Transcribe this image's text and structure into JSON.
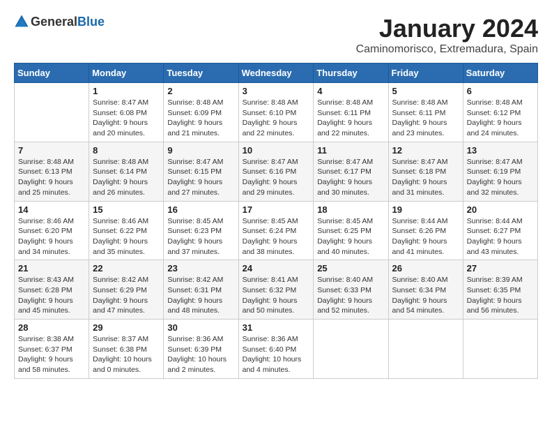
{
  "logo": {
    "text_general": "General",
    "text_blue": "Blue"
  },
  "title": "January 2024",
  "subtitle": "Caminomorisco, Extremadura, Spain",
  "headers": [
    "Sunday",
    "Monday",
    "Tuesday",
    "Wednesday",
    "Thursday",
    "Friday",
    "Saturday"
  ],
  "weeks": [
    [
      {
        "day": "",
        "sunrise": "",
        "sunset": "",
        "daylight": ""
      },
      {
        "day": "1",
        "sunrise": "Sunrise: 8:47 AM",
        "sunset": "Sunset: 6:08 PM",
        "daylight": "Daylight: 9 hours and 20 minutes."
      },
      {
        "day": "2",
        "sunrise": "Sunrise: 8:48 AM",
        "sunset": "Sunset: 6:09 PM",
        "daylight": "Daylight: 9 hours and 21 minutes."
      },
      {
        "day": "3",
        "sunrise": "Sunrise: 8:48 AM",
        "sunset": "Sunset: 6:10 PM",
        "daylight": "Daylight: 9 hours and 22 minutes."
      },
      {
        "day": "4",
        "sunrise": "Sunrise: 8:48 AM",
        "sunset": "Sunset: 6:11 PM",
        "daylight": "Daylight: 9 hours and 22 minutes."
      },
      {
        "day": "5",
        "sunrise": "Sunrise: 8:48 AM",
        "sunset": "Sunset: 6:11 PM",
        "daylight": "Daylight: 9 hours and 23 minutes."
      },
      {
        "day": "6",
        "sunrise": "Sunrise: 8:48 AM",
        "sunset": "Sunset: 6:12 PM",
        "daylight": "Daylight: 9 hours and 24 minutes."
      }
    ],
    [
      {
        "day": "7",
        "sunrise": "Sunrise: 8:48 AM",
        "sunset": "Sunset: 6:13 PM",
        "daylight": "Daylight: 9 hours and 25 minutes."
      },
      {
        "day": "8",
        "sunrise": "Sunrise: 8:48 AM",
        "sunset": "Sunset: 6:14 PM",
        "daylight": "Daylight: 9 hours and 26 minutes."
      },
      {
        "day": "9",
        "sunrise": "Sunrise: 8:47 AM",
        "sunset": "Sunset: 6:15 PM",
        "daylight": "Daylight: 9 hours and 27 minutes."
      },
      {
        "day": "10",
        "sunrise": "Sunrise: 8:47 AM",
        "sunset": "Sunset: 6:16 PM",
        "daylight": "Daylight: 9 hours and 29 minutes."
      },
      {
        "day": "11",
        "sunrise": "Sunrise: 8:47 AM",
        "sunset": "Sunset: 6:17 PM",
        "daylight": "Daylight: 9 hours and 30 minutes."
      },
      {
        "day": "12",
        "sunrise": "Sunrise: 8:47 AM",
        "sunset": "Sunset: 6:18 PM",
        "daylight": "Daylight: 9 hours and 31 minutes."
      },
      {
        "day": "13",
        "sunrise": "Sunrise: 8:47 AM",
        "sunset": "Sunset: 6:19 PM",
        "daylight": "Daylight: 9 hours and 32 minutes."
      }
    ],
    [
      {
        "day": "14",
        "sunrise": "Sunrise: 8:46 AM",
        "sunset": "Sunset: 6:20 PM",
        "daylight": "Daylight: 9 hours and 34 minutes."
      },
      {
        "day": "15",
        "sunrise": "Sunrise: 8:46 AM",
        "sunset": "Sunset: 6:22 PM",
        "daylight": "Daylight: 9 hours and 35 minutes."
      },
      {
        "day": "16",
        "sunrise": "Sunrise: 8:45 AM",
        "sunset": "Sunset: 6:23 PM",
        "daylight": "Daylight: 9 hours and 37 minutes."
      },
      {
        "day": "17",
        "sunrise": "Sunrise: 8:45 AM",
        "sunset": "Sunset: 6:24 PM",
        "daylight": "Daylight: 9 hours and 38 minutes."
      },
      {
        "day": "18",
        "sunrise": "Sunrise: 8:45 AM",
        "sunset": "Sunset: 6:25 PM",
        "daylight": "Daylight: 9 hours and 40 minutes."
      },
      {
        "day": "19",
        "sunrise": "Sunrise: 8:44 AM",
        "sunset": "Sunset: 6:26 PM",
        "daylight": "Daylight: 9 hours and 41 minutes."
      },
      {
        "day": "20",
        "sunrise": "Sunrise: 8:44 AM",
        "sunset": "Sunset: 6:27 PM",
        "daylight": "Daylight: 9 hours and 43 minutes."
      }
    ],
    [
      {
        "day": "21",
        "sunrise": "Sunrise: 8:43 AM",
        "sunset": "Sunset: 6:28 PM",
        "daylight": "Daylight: 9 hours and 45 minutes."
      },
      {
        "day": "22",
        "sunrise": "Sunrise: 8:42 AM",
        "sunset": "Sunset: 6:29 PM",
        "daylight": "Daylight: 9 hours and 47 minutes."
      },
      {
        "day": "23",
        "sunrise": "Sunrise: 8:42 AM",
        "sunset": "Sunset: 6:31 PM",
        "daylight": "Daylight: 9 hours and 48 minutes."
      },
      {
        "day": "24",
        "sunrise": "Sunrise: 8:41 AM",
        "sunset": "Sunset: 6:32 PM",
        "daylight": "Daylight: 9 hours and 50 minutes."
      },
      {
        "day": "25",
        "sunrise": "Sunrise: 8:40 AM",
        "sunset": "Sunset: 6:33 PM",
        "daylight": "Daylight: 9 hours and 52 minutes."
      },
      {
        "day": "26",
        "sunrise": "Sunrise: 8:40 AM",
        "sunset": "Sunset: 6:34 PM",
        "daylight": "Daylight: 9 hours and 54 minutes."
      },
      {
        "day": "27",
        "sunrise": "Sunrise: 8:39 AM",
        "sunset": "Sunset: 6:35 PM",
        "daylight": "Daylight: 9 hours and 56 minutes."
      }
    ],
    [
      {
        "day": "28",
        "sunrise": "Sunrise: 8:38 AM",
        "sunset": "Sunset: 6:37 PM",
        "daylight": "Daylight: 9 hours and 58 minutes."
      },
      {
        "day": "29",
        "sunrise": "Sunrise: 8:37 AM",
        "sunset": "Sunset: 6:38 PM",
        "daylight": "Daylight: 10 hours and 0 minutes."
      },
      {
        "day": "30",
        "sunrise": "Sunrise: 8:36 AM",
        "sunset": "Sunset: 6:39 PM",
        "daylight": "Daylight: 10 hours and 2 minutes."
      },
      {
        "day": "31",
        "sunrise": "Sunrise: 8:36 AM",
        "sunset": "Sunset: 6:40 PM",
        "daylight": "Daylight: 10 hours and 4 minutes."
      },
      {
        "day": "",
        "sunrise": "",
        "sunset": "",
        "daylight": ""
      },
      {
        "day": "",
        "sunrise": "",
        "sunset": "",
        "daylight": ""
      },
      {
        "day": "",
        "sunrise": "",
        "sunset": "",
        "daylight": ""
      }
    ]
  ]
}
